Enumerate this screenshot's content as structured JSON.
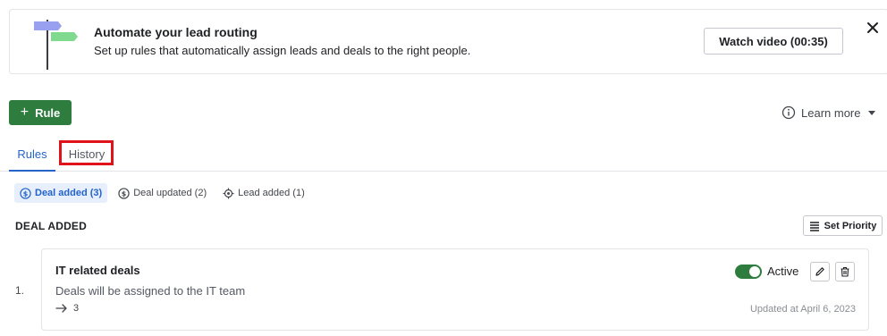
{
  "banner": {
    "title": "Automate your lead routing",
    "subtitle": "Set up rules that automatically assign leads and deals to the right people.",
    "watch_label": "Watch video (00:35)",
    "close_icon": "close-icon",
    "illustration": "signpost-illustration"
  },
  "toolbar": {
    "add_rule_label": "Rule",
    "add_icon": "plus-icon",
    "learn_more_label": "Learn more",
    "info_icon": "info-icon"
  },
  "tabs": [
    {
      "label": "Rules",
      "active": true
    },
    {
      "label": "History",
      "active": false
    }
  ],
  "filters": [
    {
      "label": "Deal added (3)",
      "icon": "dollar-circle-icon",
      "active": true
    },
    {
      "label": "Deal updated (2)",
      "icon": "dollar-circle-icon",
      "active": false
    },
    {
      "label": "Lead added (1)",
      "icon": "target-icon",
      "active": false
    }
  ],
  "section": {
    "title": "DEAL ADDED",
    "set_priority_label": "Set Priority"
  },
  "rules": [
    {
      "number": "1.",
      "title": "IT related deals",
      "description": "Deals will be assigned to the IT team",
      "assignee_count": "3",
      "status": "Active",
      "enabled": true,
      "updated": "Updated at April 6, 2023"
    }
  ],
  "colors": {
    "primary_green": "#2f7d3e",
    "link_blue": "#2563c9",
    "highlight_red": "#e0131a",
    "chip_bg": "#e6effb"
  }
}
